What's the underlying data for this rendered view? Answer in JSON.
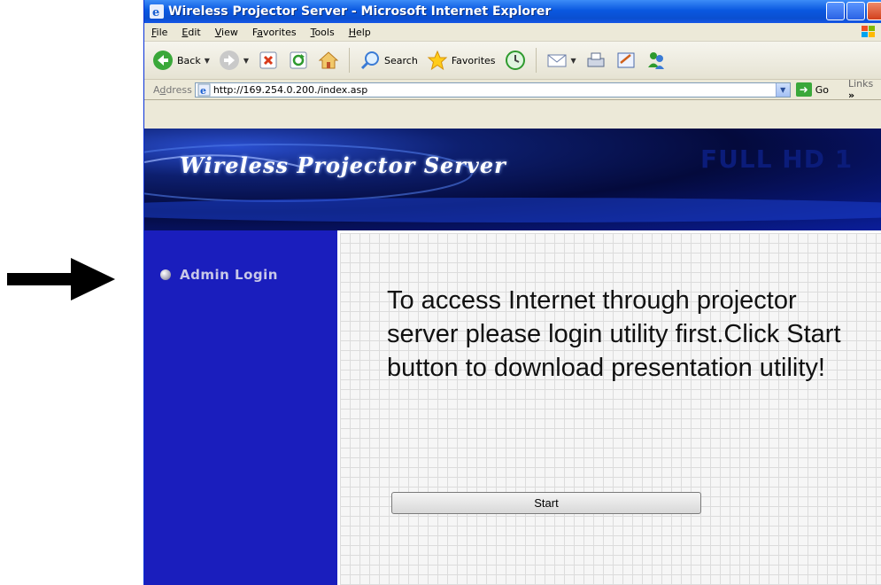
{
  "window": {
    "title": "Wireless Projector Server - Microsoft Internet Explorer"
  },
  "menu": {
    "items": [
      {
        "accel": "F",
        "rest": "ile"
      },
      {
        "accel": "E",
        "rest": "dit"
      },
      {
        "accel": "V",
        "rest": "iew"
      },
      {
        "pre": "F",
        "accel": "a",
        "rest": "vorites"
      },
      {
        "accel": "T",
        "rest": "ools"
      },
      {
        "accel": "H",
        "rest": "elp"
      }
    ]
  },
  "toolbar": {
    "back_label": "Back",
    "search_label": "Search",
    "favorites_label": "Favorites"
  },
  "address": {
    "label_pre": "A",
    "label_accel": "d",
    "label_rest": "dress",
    "url": "http://169.254.0.200./index.asp",
    "go_label": "Go",
    "links_label": "Links",
    "links_chevron": "»"
  },
  "banner": {
    "title": "Wireless Projector Server",
    "watermark": "FULL HD 1"
  },
  "sidebar": {
    "admin_login": "Admin Login"
  },
  "main": {
    "message": "To access Internet through projector server please login utility first.Click Start button to download presentation utility!",
    "start_button": "Start"
  },
  "colors": {
    "sidebar": "#1a1ebd",
    "titlebar": "#0a58e0"
  }
}
